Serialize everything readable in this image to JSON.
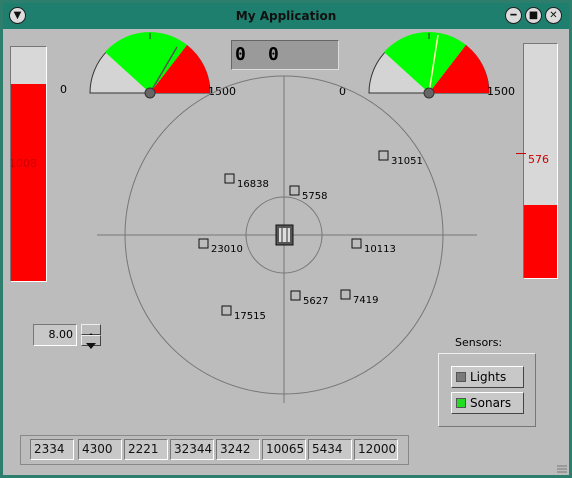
{
  "window": {
    "title": "My Application",
    "menu_icon": "down-arrow-icon",
    "minimize_icon": "minimize-icon",
    "maximize_icon": "maximize-icon",
    "close_icon": "close-icon"
  },
  "left_bar": {
    "value_label": "1008",
    "fill_fraction": 0.84
  },
  "right_bar": {
    "value_label": "576",
    "fill_fraction": 0.31
  },
  "left_gauge": {
    "min_label": "0",
    "max_label": "1500"
  },
  "right_gauge": {
    "min_label": "0",
    "max_label": "1500"
  },
  "counter": {
    "value1": "0",
    "value2": "0"
  },
  "radar": {
    "targets": [
      {
        "id": "31051"
      },
      {
        "id": "16838"
      },
      {
        "id": "5758"
      },
      {
        "id": "23010"
      },
      {
        "id": "10113"
      },
      {
        "id": "5627"
      },
      {
        "id": "7419"
      },
      {
        "id": "17515"
      }
    ]
  },
  "spinner": {
    "value": "8.00"
  },
  "sensors": {
    "title": "Sensors:",
    "lights": {
      "label": "Lights",
      "led_color": "#7a7a7a"
    },
    "sonars": {
      "label": "Sonars",
      "led_color": "#22dd22"
    }
  },
  "readouts": [
    "2334",
    "4300",
    "2221",
    "32344",
    "3242",
    "10065",
    "5434",
    "12000"
  ],
  "colors": {
    "title_bar": "#1f7f6f",
    "bar_fill": "#ff0000",
    "gauge_green": "#00ff00",
    "gauge_red": "#ff0000",
    "led_on": "#22dd22"
  }
}
